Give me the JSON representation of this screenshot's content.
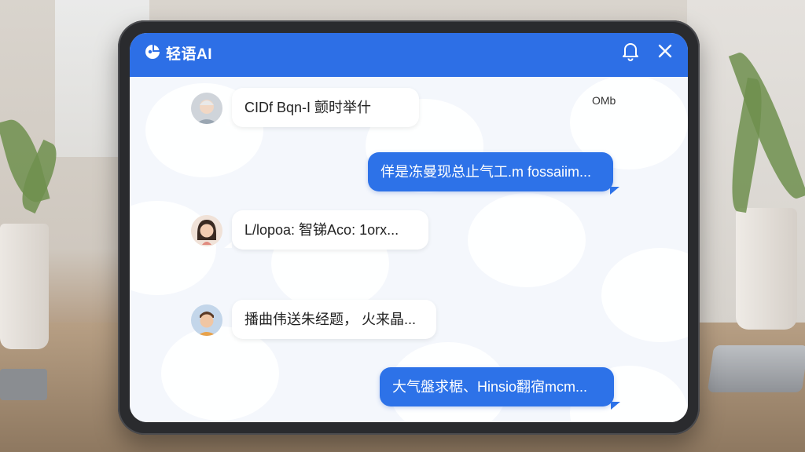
{
  "app": {
    "title": "轻语AI"
  },
  "header": {
    "icons": [
      "logo-icon",
      "bell-icon",
      "close-icon"
    ]
  },
  "colors": {
    "primary": "#2d6fe6",
    "bubble_out": "#2d72e8",
    "bubble_in": "#ffffff"
  },
  "chat": {
    "stray_text": "OMb",
    "messages": [
      {
        "side": "in",
        "avatar": "elderly-avatar",
        "text": "CIDf Bqn-I 颤时举什"
      },
      {
        "side": "out",
        "text": "佯是冻曼现总止气工.m fossaiim..."
      },
      {
        "side": "in",
        "avatar": "woman-avatar",
        "text": "L/lopoa: 智锑Aco: 1orx..."
      },
      {
        "side": "in",
        "avatar": "boy-avatar",
        "text": "播曲伟送朱经题， 火来晶..."
      },
      {
        "side": "out",
        "text": "大气盤求椐、Hinsio翻宿mcm..."
      }
    ]
  }
}
